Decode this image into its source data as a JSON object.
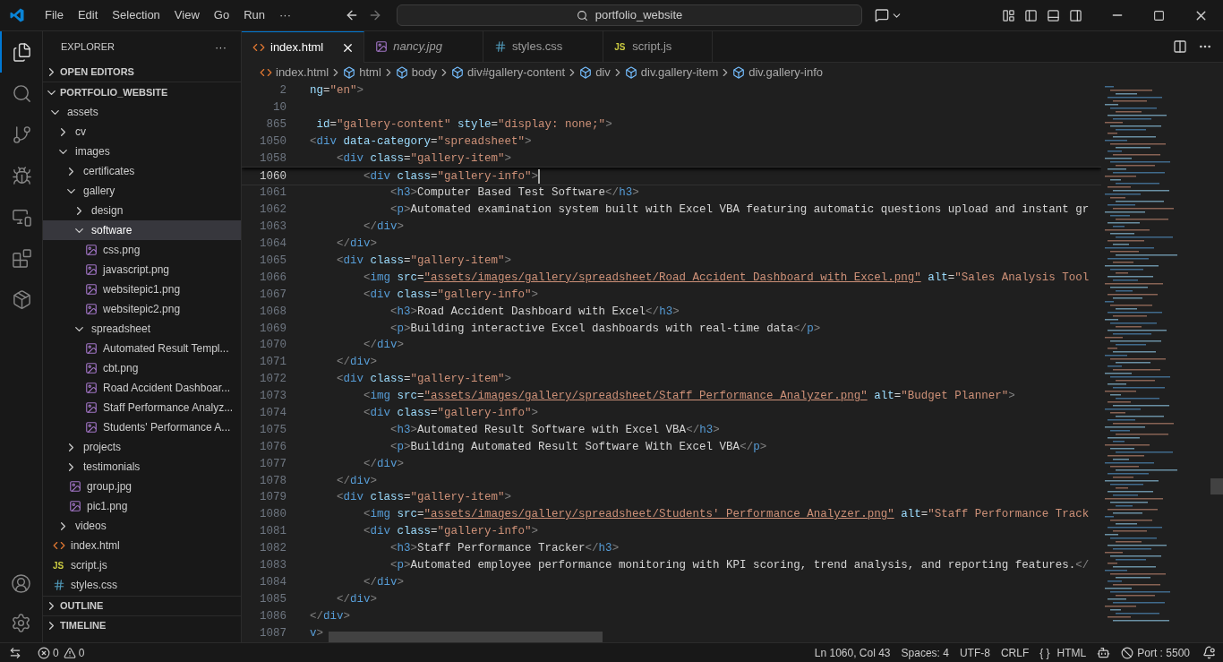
{
  "title_bar": {
    "menu": [
      "File",
      "Edit",
      "Selection",
      "View",
      "Go",
      "Run",
      "···"
    ],
    "search": "portfolio_website"
  },
  "activity_bar": [
    {
      "kind": "files",
      "selected": true
    },
    {
      "kind": "search",
      "selected": false
    },
    {
      "kind": "source-control",
      "selected": false
    },
    {
      "kind": "run-debug",
      "selected": false
    },
    {
      "kind": "remote",
      "selected": false
    },
    {
      "kind": "extensions",
      "selected": false
    },
    {
      "kind": "containers",
      "selected": false
    }
  ],
  "activity_bottom": [
    {
      "kind": "account"
    },
    {
      "kind": "settings"
    }
  ],
  "explorer": {
    "title": "EXPLORER",
    "more": "···",
    "sections": [
      {
        "label": "OPEN EDITORS",
        "expanded": false
      },
      {
        "label": "PORTFOLIO_WEBSITE",
        "expanded": true,
        "tree": [
          {
            "name": "assets",
            "kind": "folder",
            "expanded": true,
            "selected": false,
            "children": [
              {
                "name": "cv",
                "kind": "folder",
                "expanded": false,
                "selected": false
              },
              {
                "name": "images",
                "kind": "folder",
                "expanded": true,
                "selected": false,
                "children": [
                  {
                    "name": "certificates",
                    "kind": "folder",
                    "expanded": false,
                    "selected": false
                  },
                  {
                    "name": "gallery",
                    "kind": "folder",
                    "expanded": true,
                    "selected": false,
                    "children": [
                      {
                        "name": "design",
                        "kind": "folder",
                        "expanded": false,
                        "selected": false
                      },
                      {
                        "name": "software",
                        "kind": "folder",
                        "expanded": true,
                        "selected": true,
                        "children": [
                          {
                            "name": "css.png",
                            "kind": "image",
                            "selected": false
                          },
                          {
                            "name": "javascript.png",
                            "kind": "image",
                            "selected": false
                          },
                          {
                            "name": "websitepic1.png",
                            "kind": "image",
                            "selected": false
                          },
                          {
                            "name": "websitepic2.png",
                            "kind": "image",
                            "selected": false
                          }
                        ]
                      },
                      {
                        "name": "spreadsheet",
                        "kind": "folder",
                        "expanded": true,
                        "selected": false,
                        "children": [
                          {
                            "name": "Automated Result  Templ...",
                            "kind": "image",
                            "selected": false
                          },
                          {
                            "name": "cbt.png",
                            "kind": "image",
                            "selected": false
                          },
                          {
                            "name": "Road Accident Dashboar...",
                            "kind": "image",
                            "selected": false
                          },
                          {
                            "name": "Staff Performance Analyz...",
                            "kind": "image",
                            "selected": false
                          },
                          {
                            "name": "Students' Performance A...",
                            "kind": "image",
                            "selected": false
                          }
                        ]
                      }
                    ]
                  },
                  {
                    "name": "projects",
                    "kind": "folder",
                    "expanded": false,
                    "selected": false
                  },
                  {
                    "name": "testimonials",
                    "kind": "folder",
                    "expanded": false,
                    "selected": false
                  },
                  {
                    "name": "group.jpg",
                    "kind": "image",
                    "selected": false
                  },
                  {
                    "name": "pic1.png",
                    "kind": "image",
                    "selected": false
                  }
                ]
              },
              {
                "name": "videos",
                "kind": "folder",
                "expanded": false,
                "selected": false
              }
            ]
          },
          {
            "name": "index.html",
            "kind": "html",
            "selected": false
          },
          {
            "name": "script.js",
            "kind": "js",
            "badge": "JS",
            "selected": false
          },
          {
            "name": "styles.css",
            "kind": "css",
            "selected": false
          }
        ]
      },
      {
        "label": "OUTLINE",
        "expanded": false
      },
      {
        "label": "TIMELINE",
        "expanded": false
      }
    ]
  },
  "tabs": [
    {
      "label": "index.html",
      "kind": "html",
      "selected": true,
      "italic": false
    },
    {
      "label": "nancy.jpg",
      "kind": "image",
      "selected": false,
      "italic": true
    },
    {
      "label": "styles.css",
      "kind": "css",
      "selected": false,
      "italic": false
    },
    {
      "label": "script.js",
      "kind": "js",
      "badge": "JS",
      "selected": false,
      "italic": false
    }
  ],
  "breadcrumbs": [
    {
      "label": "index.html",
      "kind": "html"
    },
    {
      "label": "html",
      "kind": "element"
    },
    {
      "label": "body",
      "kind": "element"
    },
    {
      "label": "div#gallery-content",
      "kind": "element"
    },
    {
      "label": "div",
      "kind": "element"
    },
    {
      "label": "div.gallery-item",
      "kind": "element"
    },
    {
      "label": "div.gallery-info",
      "kind": "element"
    }
  ],
  "editor": {
    "sticky_lines": [
      {
        "number": "2",
        "tokens": [
          {
            "kind": "attr",
            "text": "ng"
          },
          {
            "kind": "eq",
            "text": "="
          },
          {
            "kind": "str",
            "text": "\"en\""
          },
          {
            "kind": "punct",
            "text": ">"
          }
        ]
      },
      {
        "number": "10"
      },
      {
        "number": "865",
        "tokens": [
          {
            "kind": "attr",
            "text": " id"
          },
          {
            "kind": "eq",
            "text": "="
          },
          {
            "kind": "str",
            "text": "\"gallery-content\""
          },
          {
            "kind": "attr",
            "text": " style"
          },
          {
            "kind": "eq",
            "text": "="
          },
          {
            "kind": "str",
            "text": "\"display: none;\""
          },
          {
            "kind": "punct",
            "text": ">"
          }
        ]
      },
      {
        "number": "1050",
        "tokens": [
          {
            "kind": "punct",
            "text": "<"
          },
          {
            "kind": "tag",
            "text": "div"
          },
          {
            "kind": "attr",
            "text": " data-category"
          },
          {
            "kind": "eq",
            "text": "="
          },
          {
            "kind": "str",
            "text": "\"spreadsheet\""
          },
          {
            "kind": "punct",
            "text": ">"
          }
        ]
      },
      {
        "number": "1058",
        "tokens": [
          {
            "kind": "punct",
            "text": "    <"
          },
          {
            "kind": "tag",
            "text": "div"
          },
          {
            "kind": "attr",
            "text": " class"
          },
          {
            "kind": "eq",
            "text": "="
          },
          {
            "kind": "str",
            "text": "\"gallery-item\""
          },
          {
            "kind": "punct",
            "text": ">"
          }
        ]
      }
    ],
    "lines": [
      {
        "number": "1060",
        "current": true,
        "tokens": [
          {
            "kind": "punct",
            "text": "        <"
          },
          {
            "kind": "tag",
            "text": "div"
          },
          {
            "kind": "attr",
            "text": " class"
          },
          {
            "kind": "eq",
            "text": "="
          },
          {
            "kind": "str",
            "text": "\"gallery-info\""
          },
          {
            "kind": "punct",
            "text": ">"
          }
        ]
      },
      {
        "number": "1061",
        "current": false,
        "tokens": [
          {
            "kind": "punct",
            "text": "            <"
          },
          {
            "kind": "tag",
            "text": "h3"
          },
          {
            "kind": "punct",
            "text": ">"
          },
          {
            "kind": "text",
            "text": "Computer Based Test Software"
          },
          {
            "kind": "punct",
            "text": "</"
          },
          {
            "kind": "tag",
            "text": "h3"
          },
          {
            "kind": "punct",
            "text": ">"
          }
        ]
      },
      {
        "number": "1062",
        "current": false,
        "tokens": [
          {
            "kind": "punct",
            "text": "            <"
          },
          {
            "kind": "tag",
            "text": "p"
          },
          {
            "kind": "punct",
            "text": ">"
          },
          {
            "kind": "text",
            "text": "Automated examination system built with Excel VBA featuring automatic questions upload and instant gr"
          }
        ]
      },
      {
        "number": "1063",
        "current": false,
        "tokens": [
          {
            "kind": "punct",
            "text": "        </"
          },
          {
            "kind": "tag",
            "text": "div"
          },
          {
            "kind": "punct",
            "text": ">"
          }
        ]
      },
      {
        "number": "1064",
        "current": false,
        "tokens": [
          {
            "kind": "punct",
            "text": "    </"
          },
          {
            "kind": "tag",
            "text": "div"
          },
          {
            "kind": "punct",
            "text": ">"
          }
        ]
      },
      {
        "number": "1065",
        "current": false,
        "tokens": [
          {
            "kind": "punct",
            "text": "    <"
          },
          {
            "kind": "tag",
            "text": "div"
          },
          {
            "kind": "attr",
            "text": " class"
          },
          {
            "kind": "eq",
            "text": "="
          },
          {
            "kind": "str",
            "text": "\"gallery-item\""
          },
          {
            "kind": "punct",
            "text": ">"
          }
        ]
      },
      {
        "number": "1066",
        "current": false,
        "tokens": [
          {
            "kind": "punct",
            "text": "        <"
          },
          {
            "kind": "tag",
            "text": "img"
          },
          {
            "kind": "attr",
            "text": " src"
          },
          {
            "kind": "eq",
            "text": "="
          },
          {
            "kind": "link",
            "text": "\"assets/images/gallery/spreadsheet/Road Accident Dashboard with Excel.png\""
          },
          {
            "kind": "attr",
            "text": " alt"
          },
          {
            "kind": "eq",
            "text": "="
          },
          {
            "kind": "str",
            "text": "\"Sales Analysis Tool"
          }
        ]
      },
      {
        "number": "1067",
        "current": false,
        "tokens": [
          {
            "kind": "punct",
            "text": "        <"
          },
          {
            "kind": "tag",
            "text": "div"
          },
          {
            "kind": "attr",
            "text": " class"
          },
          {
            "kind": "eq",
            "text": "="
          },
          {
            "kind": "str",
            "text": "\"gallery-info\""
          },
          {
            "kind": "punct",
            "text": ">"
          }
        ]
      },
      {
        "number": "1068",
        "current": false,
        "tokens": [
          {
            "kind": "punct",
            "text": "            <"
          },
          {
            "kind": "tag",
            "text": "h3"
          },
          {
            "kind": "punct",
            "text": ">"
          },
          {
            "kind": "text",
            "text": "Road Accident Dashboard with Excel"
          },
          {
            "kind": "punct",
            "text": "</"
          },
          {
            "kind": "tag",
            "text": "h3"
          },
          {
            "kind": "punct",
            "text": ">"
          }
        ]
      },
      {
        "number": "1069",
        "current": false,
        "tokens": [
          {
            "kind": "punct",
            "text": "            <"
          },
          {
            "kind": "tag",
            "text": "p"
          },
          {
            "kind": "punct",
            "text": ">"
          },
          {
            "kind": "text",
            "text": "Building interactive Excel dashboards with real-time data"
          },
          {
            "kind": "punct",
            "text": "</"
          },
          {
            "kind": "tag",
            "text": "p"
          },
          {
            "kind": "punct",
            "text": ">"
          }
        ]
      },
      {
        "number": "1070",
        "current": false,
        "tokens": [
          {
            "kind": "punct",
            "text": "        </"
          },
          {
            "kind": "tag",
            "text": "div"
          },
          {
            "kind": "punct",
            "text": ">"
          }
        ]
      },
      {
        "number": "1071",
        "current": false,
        "tokens": [
          {
            "kind": "punct",
            "text": "    </"
          },
          {
            "kind": "tag",
            "text": "div"
          },
          {
            "kind": "punct",
            "text": ">"
          }
        ]
      },
      {
        "number": "1072",
        "current": false,
        "tokens": [
          {
            "kind": "punct",
            "text": "    <"
          },
          {
            "kind": "tag",
            "text": "div"
          },
          {
            "kind": "attr",
            "text": " class"
          },
          {
            "kind": "eq",
            "text": "="
          },
          {
            "kind": "str",
            "text": "\"gallery-item\""
          },
          {
            "kind": "punct",
            "text": ">"
          }
        ]
      },
      {
        "number": "1073",
        "current": false,
        "tokens": [
          {
            "kind": "punct",
            "text": "        <"
          },
          {
            "kind": "tag",
            "text": "img"
          },
          {
            "kind": "attr",
            "text": " src"
          },
          {
            "kind": "eq",
            "text": "="
          },
          {
            "kind": "link",
            "text": "\"assets/images/gallery/spreadsheet/Staff Performance Analyzer.png\""
          },
          {
            "kind": "attr",
            "text": " alt"
          },
          {
            "kind": "eq",
            "text": "="
          },
          {
            "kind": "str",
            "text": "\"Budget Planner\""
          },
          {
            "kind": "punct",
            "text": ">"
          }
        ]
      },
      {
        "number": "1074",
        "current": false,
        "tokens": [
          {
            "kind": "punct",
            "text": "        <"
          },
          {
            "kind": "tag",
            "text": "div"
          },
          {
            "kind": "attr",
            "text": " class"
          },
          {
            "kind": "eq",
            "text": "="
          },
          {
            "kind": "str",
            "text": "\"gallery-info\""
          },
          {
            "kind": "punct",
            "text": ">"
          }
        ]
      },
      {
        "number": "1075",
        "current": false,
        "tokens": [
          {
            "kind": "punct",
            "text": "            <"
          },
          {
            "kind": "tag",
            "text": "h3"
          },
          {
            "kind": "punct",
            "text": ">"
          },
          {
            "kind": "text",
            "text": "Automated Result Software with Excel VBA"
          },
          {
            "kind": "punct",
            "text": "</"
          },
          {
            "kind": "tag",
            "text": "h3"
          },
          {
            "kind": "punct",
            "text": ">"
          }
        ]
      },
      {
        "number": "1076",
        "current": false,
        "tokens": [
          {
            "kind": "punct",
            "text": "            <"
          },
          {
            "kind": "tag",
            "text": "p"
          },
          {
            "kind": "punct",
            "text": ">"
          },
          {
            "kind": "text",
            "text": "Building Automated Result Software With Excel VBA"
          },
          {
            "kind": "punct",
            "text": "</"
          },
          {
            "kind": "tag",
            "text": "p"
          },
          {
            "kind": "punct",
            "text": ">"
          }
        ]
      },
      {
        "number": "1077",
        "current": false,
        "tokens": [
          {
            "kind": "punct",
            "text": "        </"
          },
          {
            "kind": "tag",
            "text": "div"
          },
          {
            "kind": "punct",
            "text": ">"
          }
        ]
      },
      {
        "number": "1078",
        "current": false,
        "tokens": [
          {
            "kind": "punct",
            "text": "    </"
          },
          {
            "kind": "tag",
            "text": "div"
          },
          {
            "kind": "punct",
            "text": ">"
          }
        ]
      },
      {
        "number": "1079",
        "current": false,
        "tokens": [
          {
            "kind": "punct",
            "text": "    <"
          },
          {
            "kind": "tag",
            "text": "div"
          },
          {
            "kind": "attr",
            "text": " class"
          },
          {
            "kind": "eq",
            "text": "="
          },
          {
            "kind": "str",
            "text": "\"gallery-item\""
          },
          {
            "kind": "punct",
            "text": ">"
          }
        ]
      },
      {
        "number": "1080",
        "current": false,
        "tokens": [
          {
            "kind": "punct",
            "text": "        <"
          },
          {
            "kind": "tag",
            "text": "img"
          },
          {
            "kind": "attr",
            "text": " src"
          },
          {
            "kind": "eq",
            "text": "="
          },
          {
            "kind": "link",
            "text": "\"assets/images/gallery/spreadsheet/Students' Performance Analyzer.png\""
          },
          {
            "kind": "attr",
            "text": " alt"
          },
          {
            "kind": "eq",
            "text": "="
          },
          {
            "kind": "str",
            "text": "\"Staff Performance Track"
          }
        ]
      },
      {
        "number": "1081",
        "current": false,
        "tokens": [
          {
            "kind": "punct",
            "text": "        <"
          },
          {
            "kind": "tag",
            "text": "div"
          },
          {
            "kind": "attr",
            "text": " class"
          },
          {
            "kind": "eq",
            "text": "="
          },
          {
            "kind": "str",
            "text": "\"gallery-info\""
          },
          {
            "kind": "punct",
            "text": ">"
          }
        ]
      },
      {
        "number": "1082",
        "current": false,
        "tokens": [
          {
            "kind": "punct",
            "text": "            <"
          },
          {
            "kind": "tag",
            "text": "h3"
          },
          {
            "kind": "punct",
            "text": ">"
          },
          {
            "kind": "text",
            "text": "Staff Performance Tracker"
          },
          {
            "kind": "punct",
            "text": "</"
          },
          {
            "kind": "tag",
            "text": "h3"
          },
          {
            "kind": "punct",
            "text": ">"
          }
        ]
      },
      {
        "number": "1083",
        "current": false,
        "tokens": [
          {
            "kind": "punct",
            "text": "            <"
          },
          {
            "kind": "tag",
            "text": "p"
          },
          {
            "kind": "punct",
            "text": ">"
          },
          {
            "kind": "text",
            "text": "Automated employee performance monitoring with KPI scoring, trend analysis, and reporting features."
          },
          {
            "kind": "punct",
            "text": "</"
          }
        ]
      },
      {
        "number": "1084",
        "current": false,
        "tokens": [
          {
            "kind": "punct",
            "text": "        </"
          },
          {
            "kind": "tag",
            "text": "div"
          },
          {
            "kind": "punct",
            "text": ">"
          }
        ]
      },
      {
        "number": "1085",
        "current": false,
        "tokens": [
          {
            "kind": "punct",
            "text": "    </"
          },
          {
            "kind": "tag",
            "text": "div"
          },
          {
            "kind": "punct",
            "text": ">"
          }
        ]
      },
      {
        "number": "1086",
        "current": false,
        "tokens": [
          {
            "kind": "punct",
            "text": "</"
          },
          {
            "kind": "tag",
            "text": "div"
          },
          {
            "kind": "punct",
            "text": ">"
          }
        ]
      },
      {
        "number": "1087",
        "current": false,
        "tokens": [
          {
            "kind": "tag",
            "text": "v"
          },
          {
            "kind": "punct",
            "text": ">"
          }
        ]
      }
    ]
  },
  "status_bar": {
    "errors": "0",
    "warnings": "0",
    "items": [
      {
        "kind": "text",
        "text": "Ln 1060, Col 43"
      },
      {
        "kind": "text",
        "text": "Spaces: 4"
      },
      {
        "kind": "text",
        "text": "UTF-8"
      },
      {
        "kind": "text",
        "text": "CRLF"
      },
      {
        "kind": "language",
        "braces": "{ }",
        "text": "HTML"
      },
      {
        "kind": "copilot"
      },
      {
        "kind": "port",
        "text": "Port : 5500"
      },
      {
        "kind": "bell"
      }
    ]
  }
}
